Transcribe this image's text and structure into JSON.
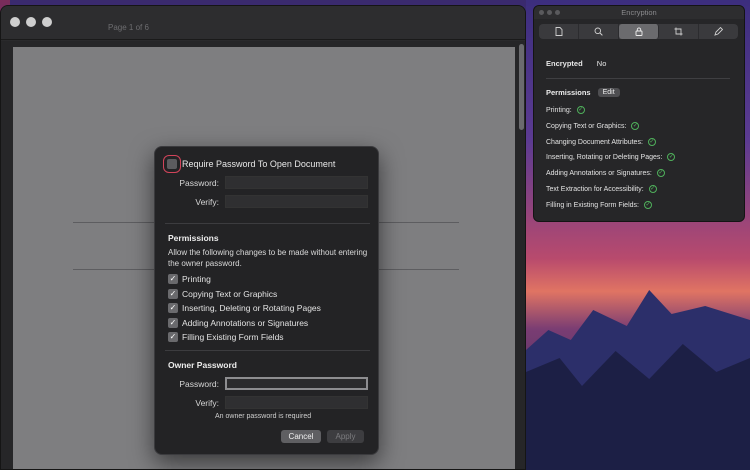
{
  "document_window": {
    "page_indicator": "Page 1 of 6"
  },
  "security_sheet": {
    "require_password_label": "Require Password To Open Document",
    "require_password_checked": false,
    "password_label": "Password:",
    "verify_label": "Verify:",
    "password_value": "",
    "verify_value": "",
    "permissions_heading": "Permissions",
    "permissions_description": "Allow the following changes to be made without entering the owner password.",
    "permissions": [
      {
        "label": "Printing",
        "checked": true
      },
      {
        "label": "Copying Text or Graphics",
        "checked": true
      },
      {
        "label": "Inserting, Deleting or Rotating Pages",
        "checked": true
      },
      {
        "label": "Adding Annotations or Signatures",
        "checked": true
      },
      {
        "label": "Filling Existing Form Fields",
        "checked": true
      }
    ],
    "owner_heading": "Owner Password",
    "owner_password_label": "Password:",
    "owner_verify_label": "Verify:",
    "owner_password_value": "",
    "owner_verify_value": "",
    "hint": "An owner password is required",
    "cancel_label": "Cancel",
    "apply_label": "Apply"
  },
  "inspector": {
    "title": "Encryption",
    "tabs": [
      {
        "icon": "document-icon"
      },
      {
        "icon": "search-icon"
      },
      {
        "icon": "lock-icon",
        "active": true
      },
      {
        "icon": "crop-icon"
      },
      {
        "icon": "pencil-icon"
      }
    ],
    "encrypted_label": "Encrypted",
    "encrypted_value": "No",
    "permissions_label": "Permissions",
    "edit_label": "Edit",
    "permissions": [
      "Printing:",
      "Copying Text or Graphics:",
      "Changing Document Attributes:",
      "Inserting, Rotating or Deleting Pages:",
      "Adding Annotations or Signatures:",
      "Text Extraction for Accessibility:",
      "Filling in Existing Form Fields:"
    ],
    "ok_color": "#4fb05b"
  }
}
